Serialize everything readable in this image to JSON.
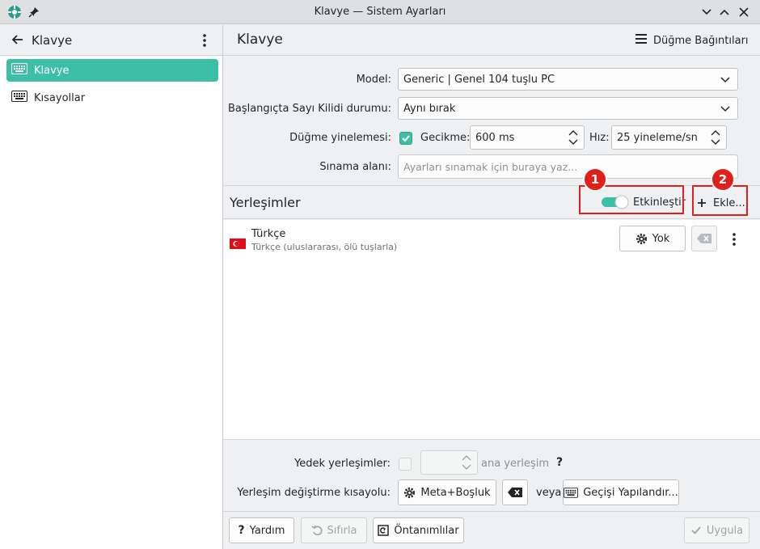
{
  "window": {
    "title": "Klavye — Sistem Ayarları"
  },
  "sidebar": {
    "header_title": "Klavye",
    "items": [
      {
        "label": "Klavye",
        "icon": "keyboard-icon",
        "active": true
      },
      {
        "label": "Kısayollar",
        "icon": "keyboard-icon",
        "active": false
      }
    ]
  },
  "main": {
    "title": "Klavye",
    "key_bindings_label": "Düğme Bağıntıları",
    "model": {
      "label": "Model:",
      "value": "Generic | Genel 104 tuşlu PC"
    },
    "numlock": {
      "label": "Başlangıçta Sayı Kilidi durumu:",
      "value": "Aynı bırak"
    },
    "repeat": {
      "label": "Düğme yinelemesi:",
      "delay_label": "Gecikme:",
      "delay_value": "600 ms",
      "rate_label": "Hız:",
      "rate_value": "25 yineleme/sn"
    },
    "test": {
      "label": "Sınama alanı:",
      "placeholder": "Ayarları sınamak için buraya yaz..."
    }
  },
  "layouts": {
    "title": "Yerleşimler",
    "enable_label": "Etkinleştir",
    "add_label": "Ekle...",
    "items": [
      {
        "name": "Türkçe",
        "description": "Türkçe (uluslararası, ölü tuşlarla)",
        "shortcut_label": "Yok"
      }
    ]
  },
  "bottom": {
    "spare_label": "Yedek yerleşimler:",
    "spare_suffix": "ana yerleşim",
    "help_mark": "?",
    "switch_label": "Yerleşim değiştirme kısayolu:",
    "shortcut_value": "Meta+Boşluk",
    "or_label": "veya",
    "configure_label": "Geçişi Yapılandır..."
  },
  "footer": {
    "help": "Yardım",
    "reset": "Sıfırla",
    "defaults": "Öntanımlılar",
    "apply": "Uygula"
  },
  "callouts": [
    "1",
    "2"
  ],
  "colors": {
    "accent": "#3dbfa6",
    "callout": "#e0201a",
    "background": "#eff0f1"
  }
}
